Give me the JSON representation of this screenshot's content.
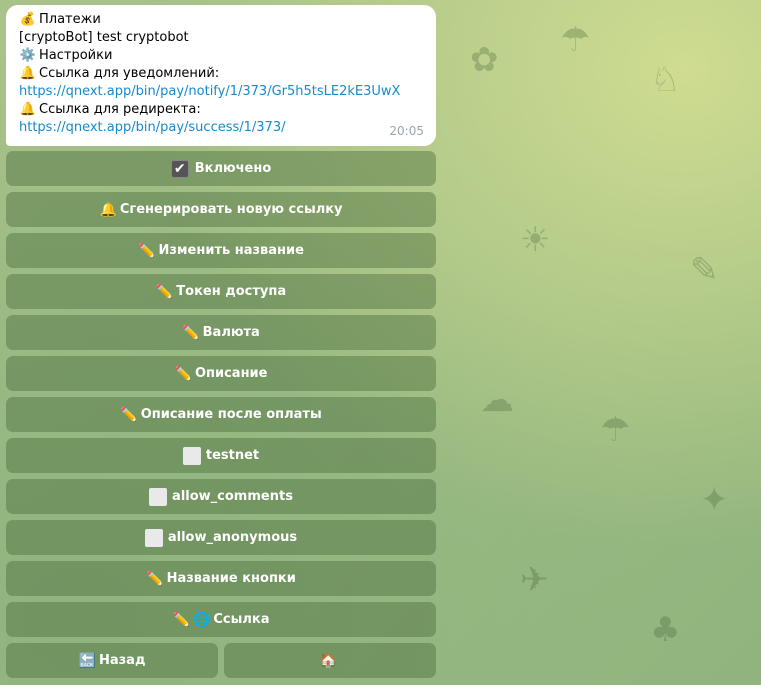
{
  "message": {
    "lines": [
      {
        "icon": "money-bag-icon",
        "glyph": "💰",
        "text": "Платежи"
      },
      {
        "text": "[cryptoBot] test cryptobot"
      },
      {
        "icon": "gear-icon",
        "glyph": "⚙️",
        "text": "Настройки"
      },
      {
        "icon": "bell-icon",
        "glyph": "🔔",
        "text": "Ссылка для уведомлений:"
      },
      {
        "link": "https://qnext.app/bin/pay/notify/1/373/Gr5h5tsLE2kE3UwX"
      },
      {
        "icon": "bell-icon",
        "glyph": "🔔",
        "text": "Ссылка для редиректа:"
      },
      {
        "link": "https://qnext.app/bin/pay/success/1/373/"
      }
    ],
    "time": "20:05"
  },
  "keyboard": {
    "enabled": {
      "glyph": "✔",
      "label": "Включено"
    },
    "generate_link": {
      "glyph": "🔔",
      "label": "Сгенерировать новую ссылку"
    },
    "rename": {
      "glyph": "✏️",
      "label": "Изменить название"
    },
    "token": {
      "glyph": "✏️",
      "label": "Токен доступа"
    },
    "currency": {
      "glyph": "✏️",
      "label": "Валюта"
    },
    "description": {
      "glyph": "✏️",
      "label": "Описание"
    },
    "description_after": {
      "glyph": "✏️",
      "label": "Описание после оплаты"
    },
    "testnet": {
      "label": "testnet"
    },
    "allow_comments": {
      "label": "allow_comments"
    },
    "allow_anonymous": {
      "label": "allow_anonymous"
    },
    "button_name": {
      "glyph": "✏️",
      "label": "Название кнопки"
    },
    "link": {
      "glyph": "✏️",
      "glyph2": "🌐",
      "label": "Ссылка"
    },
    "back": {
      "glyph": "🔙",
      "label": "Назад"
    },
    "home": {
      "glyph": "🏠"
    }
  }
}
